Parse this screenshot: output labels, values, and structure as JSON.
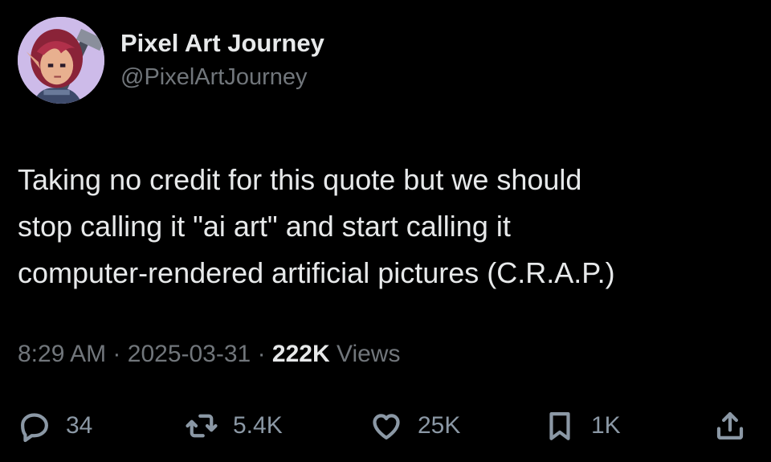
{
  "author": {
    "display_name": "Pixel Art Journey",
    "handle": "@PixelArtJourney",
    "avatar_icon": "pixel-art-character-avatar"
  },
  "tweet": {
    "text": "Taking no credit for this quote but we should\nstop calling it \"ai art\" and start calling it\ncomputer-rendered artificial pictures (C.R.A.P.)",
    "time": "8:29 AM",
    "separator": "·",
    "date": "2025-03-31",
    "views_count": "222K",
    "views_label": "Views"
  },
  "actions": {
    "reply": {
      "icon": "reply-icon",
      "count": "34"
    },
    "retweet": {
      "icon": "retweet-icon",
      "count": "5.4K"
    },
    "like": {
      "icon": "heart-icon",
      "count": "25K"
    },
    "bookmark": {
      "icon": "bookmark-icon",
      "count": "1K"
    },
    "share": {
      "icon": "share-icon"
    }
  },
  "colors": {
    "background": "#000000",
    "primary_text": "#e7e9ea",
    "secondary_text": "#71767b",
    "icon": "#8b98a5"
  }
}
